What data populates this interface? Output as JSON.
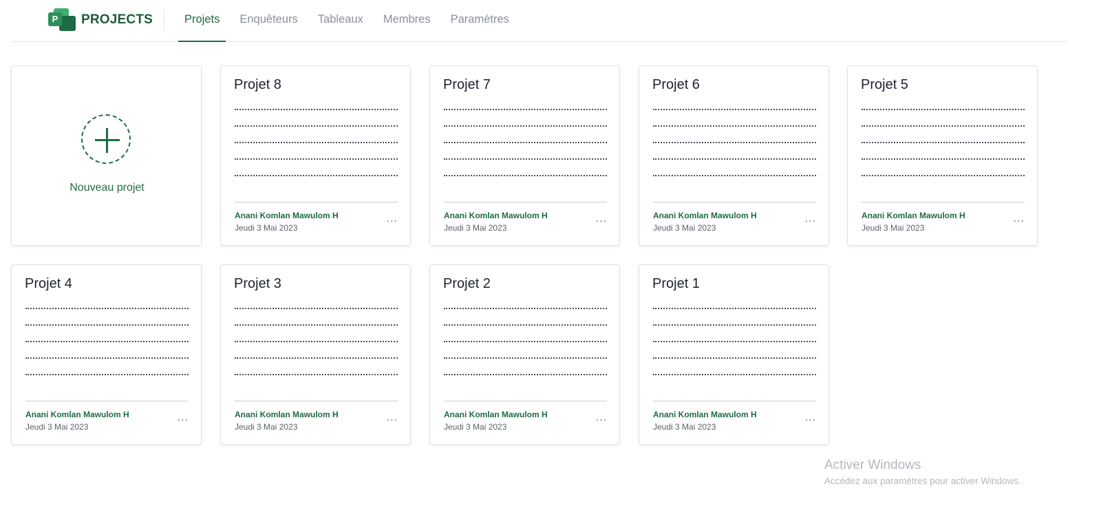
{
  "header": {
    "logo_letter": "P",
    "app_name": "PROJECTS",
    "nav": [
      {
        "label": "Projets",
        "active": true
      },
      {
        "label": "Enquêteurs",
        "active": false
      },
      {
        "label": "Tableaux",
        "active": false
      },
      {
        "label": "Membres",
        "active": false
      },
      {
        "label": "Paramètres",
        "active": false
      }
    ]
  },
  "new_project": {
    "label": "Nouveau projet"
  },
  "projects": [
    {
      "title": "Projet 8",
      "author": "Anani Komlan Mawulom H",
      "date": "Jeudi 3 Mai 2023"
    },
    {
      "title": "Projet 7",
      "author": "Anani Komlan Mawulom H",
      "date": "Jeudi 3 Mai 2023"
    },
    {
      "title": "Projet 6",
      "author": "Anani Komlan Mawulom H",
      "date": "Jeudi 3 Mai 2023"
    },
    {
      "title": "Projet 5",
      "author": "Anani Komlan Mawulom H",
      "date": "Jeudi 3 Mai 2023"
    },
    {
      "title": "Projet 4",
      "author": "Anani Komlan Mawulom H",
      "date": "Jeudi 3 Mai 2023"
    },
    {
      "title": "Projet 3",
      "author": "Anani Komlan Mawulom H",
      "date": "Jeudi 3 Mai 2023"
    },
    {
      "title": "Projet 2",
      "author": "Anani Komlan Mawulom H",
      "date": "Jeudi 3 Mai 2023"
    },
    {
      "title": "Projet 1",
      "author": "Anani Komlan Mawulom H",
      "date": "Jeudi 3 Mai 2023"
    }
  ],
  "more_label": "...",
  "watermark": {
    "line1": "Activer Windows",
    "line2": "Accédez aux paramètres pour activer Windows."
  },
  "colors": {
    "brand": "#1d6b43",
    "brand_light": "#3cae72",
    "nav_inactive": "#8a8f98",
    "border": "#dedfe3"
  },
  "icons": {
    "logo": "projects-logo-icon",
    "add": "plus-circle-icon",
    "more": "more-horizontal-icon"
  }
}
